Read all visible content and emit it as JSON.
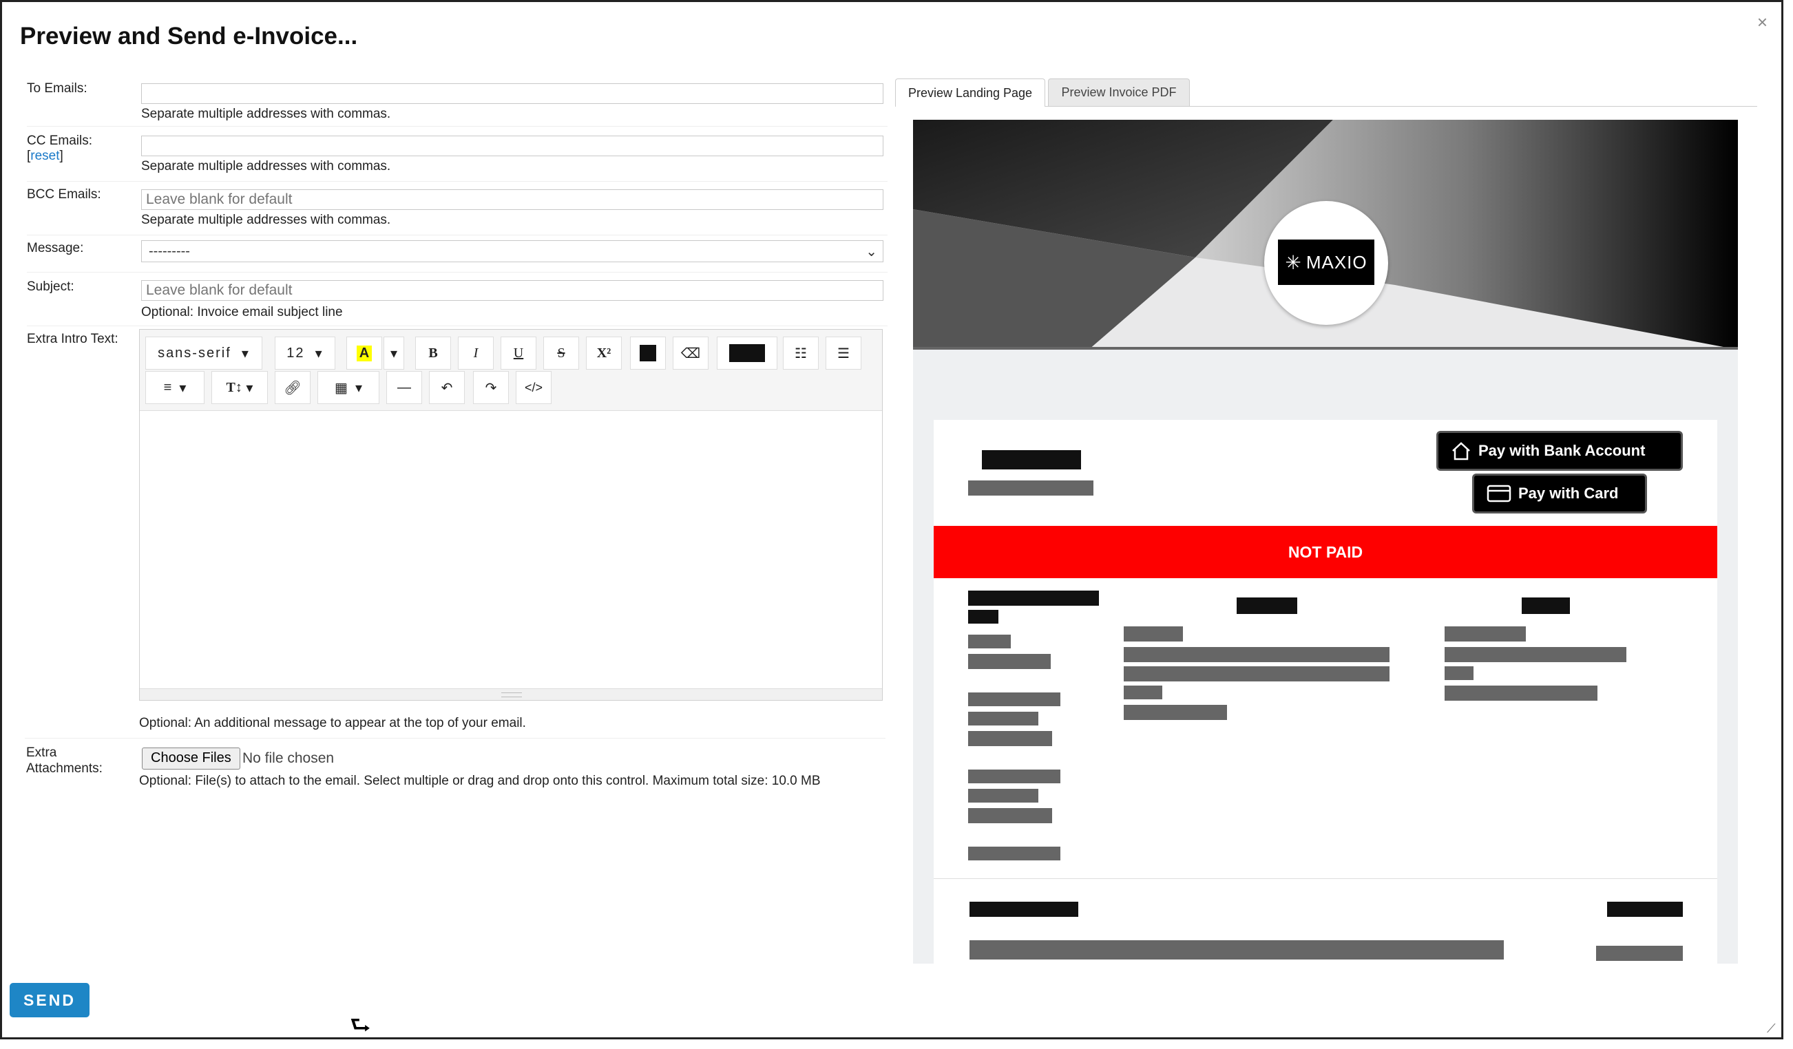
{
  "dialog": {
    "title": "Preview and Send e-Invoice...",
    "close": "×"
  },
  "form": {
    "to_label": "To Emails:",
    "to_help": "Separate multiple addresses with commas.",
    "cc_label": "CC Emails:",
    "cc_reset": "reset",
    "cc_help": "Separate multiple addresses with commas.",
    "bcc_label": "BCC Emails:",
    "bcc_placeholder": "Leave blank for default",
    "bcc_help": "Separate multiple addresses with commas.",
    "message_label": "Message:",
    "message_value": "---------",
    "subject_label": "Subject:",
    "subject_placeholder": "Leave blank for default",
    "subject_help": "Optional: Invoice email subject line",
    "intro_label": "Extra Intro Text:",
    "intro_help": "Optional: An additional message to appear at the top of your email.",
    "attach_label": "Extra Attachments:",
    "choose_files": "Choose Files",
    "no_file": "No file chosen",
    "attach_help": "Optional: File(s) to attach to the email. Select multiple or drag and drop onto this control. Maximum total size: 10.0 MB",
    "send": "SEND"
  },
  "toolbar": {
    "font": "sans-serif",
    "size": "12",
    "bold": "B",
    "italic": "I",
    "underline": "U",
    "strike": "S",
    "superscript": "X²",
    "code": "</>",
    "texttype": "T↕"
  },
  "tabs": [
    {
      "label": "Preview Landing Page"
    },
    {
      "label": "Preview Invoice PDF"
    }
  ],
  "preview": {
    "logo": "MAXIO",
    "pay_bank": "Pay with Bank Account",
    "pay_card": "Pay with Card",
    "status": "NOT PAID"
  }
}
